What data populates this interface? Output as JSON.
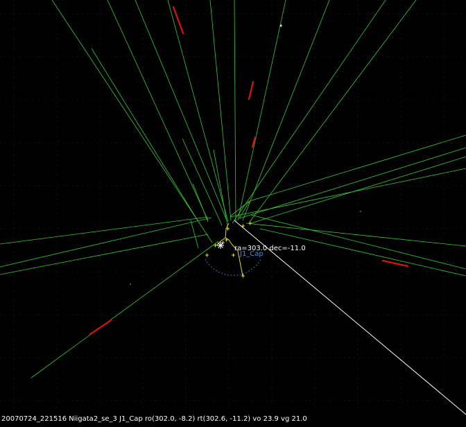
{
  "radiant": {
    "label": "ra=303.0 dec=-11.0",
    "shower_code": "J1_Cap"
  },
  "status": {
    "text": "20070724_221516 Niigata2_se_3  J1_Cap ro(302.0, -8.2) rt(302.6, -11.2) vo 23.9 vg 21.0"
  },
  "colors": {
    "background": "#000000",
    "trail_lines": "#33cc33",
    "meteor": "#dd1111",
    "radiant_path": "#dddd33",
    "radiant_circle": "#3a7fc0",
    "observed_track": "#ffffff",
    "stars": "#ffffff"
  }
}
